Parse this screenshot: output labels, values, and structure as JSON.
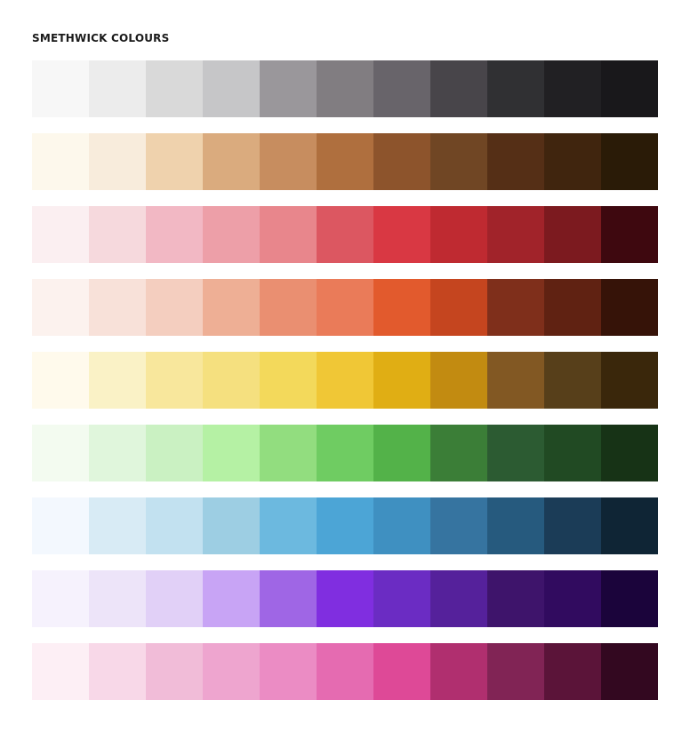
{
  "title": "SMETHWICK COLOURS",
  "palette": {
    "ramps": [
      {
        "colors": [
          "#f7f7f7",
          "#ececec",
          "#d9d9d9",
          "#c6c6c8",
          "#9a979b",
          "#817d81",
          "#68646a",
          "#48454a",
          "#303033",
          "#212023",
          "#19181b"
        ]
      },
      {
        "colors": [
          "#fdf8ec",
          "#f8ecdc",
          "#efd2ad",
          "#daab7e",
          "#c78d5f",
          "#af6f3e",
          "#8d542c",
          "#704624",
          "#552f16",
          "#40250e",
          "#2a1b07"
        ]
      },
      {
        "colors": [
          "#fbeff1",
          "#f6d9dd",
          "#f2b8c4",
          "#ed9fa8",
          "#e8868c",
          "#dc5761",
          "#d93843",
          "#bf2a31",
          "#a1232a",
          "#7c1a1f",
          "#3e080f"
        ]
      },
      {
        "colors": [
          "#fcf2ee",
          "#f8e1d9",
          "#f4cebf",
          "#eeaf95",
          "#ea8f71",
          "#ea7b59",
          "#e25a2d",
          "#c5451f",
          "#7f2f1b",
          "#602212",
          "#361308"
        ]
      },
      {
        "colors": [
          "#fffaec",
          "#faf2c6",
          "#f8e79c",
          "#f5e07f",
          "#f3d95b",
          "#f0c736",
          "#e0ae14",
          "#c28b11",
          "#825823",
          "#573f1a",
          "#3a270b"
        ]
      },
      {
        "colors": [
          "#f3fbf0",
          "#e0f6dc",
          "#caf1c2",
          "#b5f1a4",
          "#92dd7f",
          "#6fcc62",
          "#53b249",
          "#3b7e37",
          "#2c5b32",
          "#214a23",
          "#173316"
        ]
      },
      {
        "colors": [
          "#f3f8fe",
          "#d8ebf5",
          "#c2e1f0",
          "#9dcee3",
          "#6cb9df",
          "#4ca5d6",
          "#3f90c1",
          "#3674a0",
          "#265a7e",
          "#1b3c57",
          "#0f2535"
        ]
      },
      {
        "colors": [
          "#f6f2fd",
          "#ede4f9",
          "#e1d0f7",
          "#c8a4f5",
          "#9f66e5",
          "#802ee0",
          "#6b2cc3",
          "#55219b",
          "#3e146b",
          "#310b5f",
          "#1b043b"
        ]
      },
      {
        "colors": [
          "#fdeff5",
          "#f8d8e8",
          "#f1bcd8",
          "#eea5cf",
          "#eb8cc4",
          "#e56bb1",
          "#de4997",
          "#b02f6f",
          "#812455",
          "#5b1439",
          "#330820"
        ]
      }
    ]
  }
}
